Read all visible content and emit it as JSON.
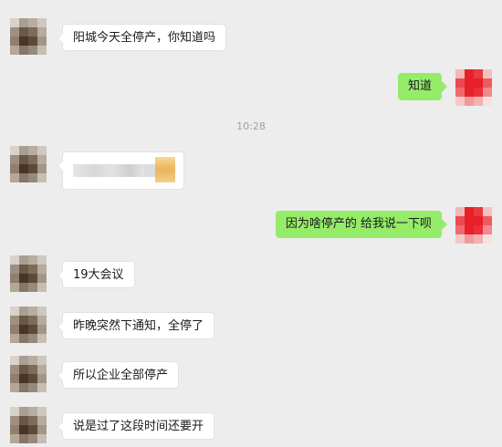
{
  "conversation": {
    "timestamp": "10:28",
    "messages": [
      {
        "side": "left",
        "text": "阳城今天全停产，你知道吗"
      },
      {
        "side": "right",
        "text": "知道"
      },
      {
        "side": "left",
        "text": "",
        "content": "blurred-image"
      },
      {
        "side": "right",
        "text": "因为啥停产的  给我说一下呗"
      },
      {
        "side": "left",
        "text": "19大会议"
      },
      {
        "side": "left",
        "text": "昨晚突然下通知，全停了"
      },
      {
        "side": "left",
        "text": "所以企业全部停产"
      },
      {
        "side": "left",
        "text": "说是过了这段时间还要开"
      }
    ]
  },
  "colors": {
    "background": "#ededed",
    "self_bubble": "#95ec69",
    "other_bubble": "#ffffff",
    "self_avatar": "#e8202a"
  }
}
